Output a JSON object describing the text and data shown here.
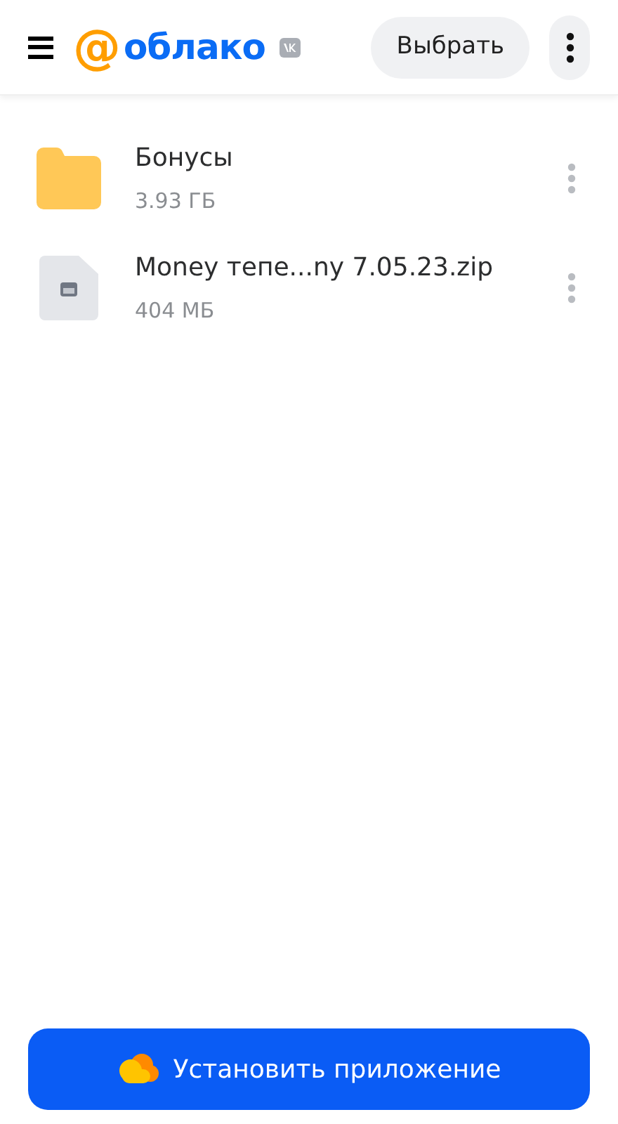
{
  "header": {
    "logo_mark": "@",
    "logo_text": "облако",
    "select_button": "Выбрать"
  },
  "files": [
    {
      "kind": "folder",
      "name": "Бонусы",
      "size": "3.93 ГБ"
    },
    {
      "kind": "file",
      "name": "Money тепе...ny 7.05.23.zip",
      "size": "404 МБ"
    }
  ],
  "install_button": "Установить приложение"
}
